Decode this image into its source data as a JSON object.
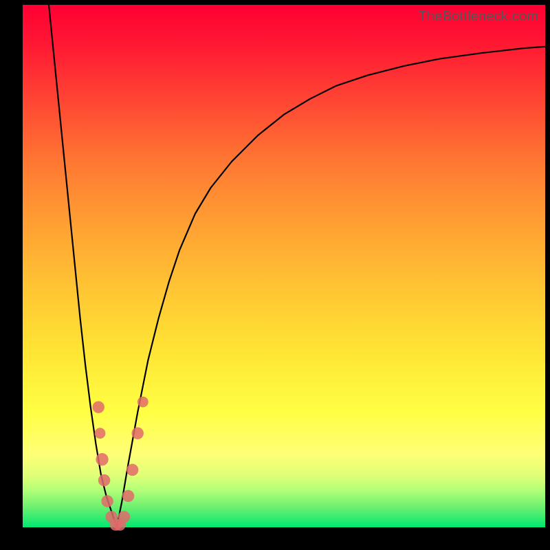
{
  "watermark": "TheBottleneck.com",
  "chart_data": {
    "type": "line",
    "title": "",
    "xlabel": "",
    "ylabel": "",
    "xlim": [
      0,
      100
    ],
    "ylim": [
      0,
      100
    ],
    "series": [
      {
        "name": "left-branch",
        "x": [
          5,
          6,
          7,
          8,
          9,
          10,
          11,
          12,
          13,
          14,
          15,
          16,
          17,
          18
        ],
        "values": [
          100,
          90,
          80,
          70,
          60,
          50,
          40,
          31,
          23,
          16,
          10,
          6,
          3,
          0
        ]
      },
      {
        "name": "right-branch",
        "x": [
          18,
          19,
          20,
          22,
          24,
          26,
          28,
          30,
          33,
          36,
          40,
          45,
          50,
          55,
          60,
          66,
          73,
          80,
          88,
          96,
          100
        ],
        "values": [
          0,
          5,
          11,
          22,
          32,
          40,
          47,
          53,
          60,
          65,
          70,
          75,
          79,
          82,
          84.5,
          86.5,
          88.3,
          89.7,
          90.8,
          91.7,
          92
        ]
      }
    ],
    "markers": {
      "name": "highlight-dots",
      "color": "#e26a6a",
      "points": [
        {
          "x": 14.5,
          "y": 23,
          "r": 1.3
        },
        {
          "x": 14.8,
          "y": 18,
          "r": 1.1
        },
        {
          "x": 15.2,
          "y": 13,
          "r": 1.4
        },
        {
          "x": 15.6,
          "y": 9,
          "r": 1.3
        },
        {
          "x": 16.2,
          "y": 5,
          "r": 1.3
        },
        {
          "x": 17.0,
          "y": 2,
          "r": 1.3
        },
        {
          "x": 17.8,
          "y": 0.5,
          "r": 1.3
        },
        {
          "x": 18.6,
          "y": 0.5,
          "r": 1.3
        },
        {
          "x": 19.4,
          "y": 2,
          "r": 1.3
        },
        {
          "x": 20.2,
          "y": 6,
          "r": 1.3
        },
        {
          "x": 21.0,
          "y": 11,
          "r": 1.3
        },
        {
          "x": 22.0,
          "y": 18,
          "r": 1.3
        },
        {
          "x": 23.0,
          "y": 24,
          "r": 1.1
        }
      ]
    }
  }
}
